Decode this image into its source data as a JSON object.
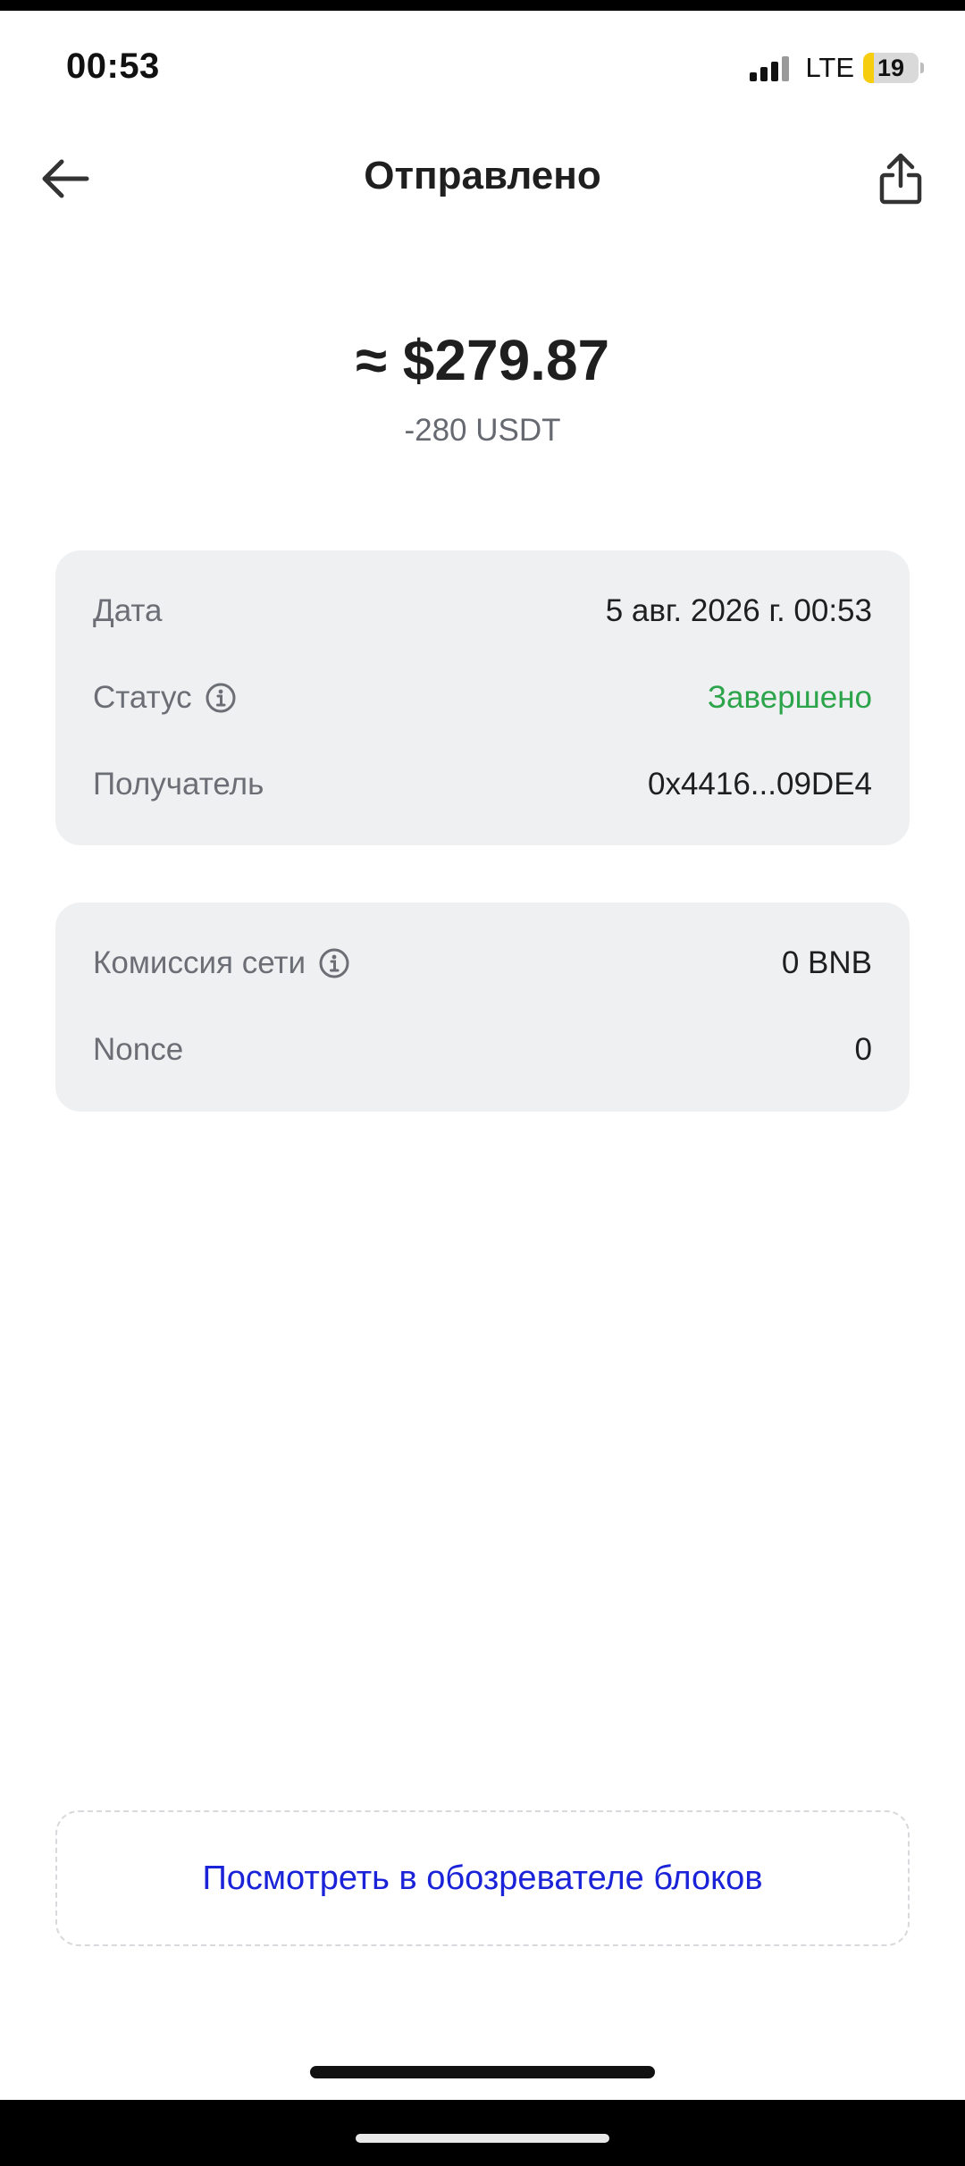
{
  "status_bar": {
    "time": "00:53",
    "network": "LTE",
    "battery": "19",
    "battery_level": 0.19
  },
  "header": {
    "title": "Отправлено",
    "back_icon": "arrow-left-icon",
    "share_icon": "share-icon"
  },
  "amount": {
    "fiat": "≈ $279.87",
    "crypto": "-280 USDT"
  },
  "details": {
    "date_label": "Дата",
    "date_value": "5 авг. 2026 г. 00:53",
    "status_label": "Статус",
    "status_value": "Завершено",
    "recipient_label": "Получатель",
    "recipient_value": "0x4416...09DE4"
  },
  "fees": {
    "fee_label": "Комиссия сети",
    "fee_value": "0 BNB",
    "nonce_label": "Nonce",
    "nonce_value": "0"
  },
  "explorer_button": "Посмотреть в обозревателе блоков",
  "colors": {
    "status_success": "#2ba44a",
    "link_blue": "#1a23d8",
    "card_background": "#eff0f2"
  }
}
